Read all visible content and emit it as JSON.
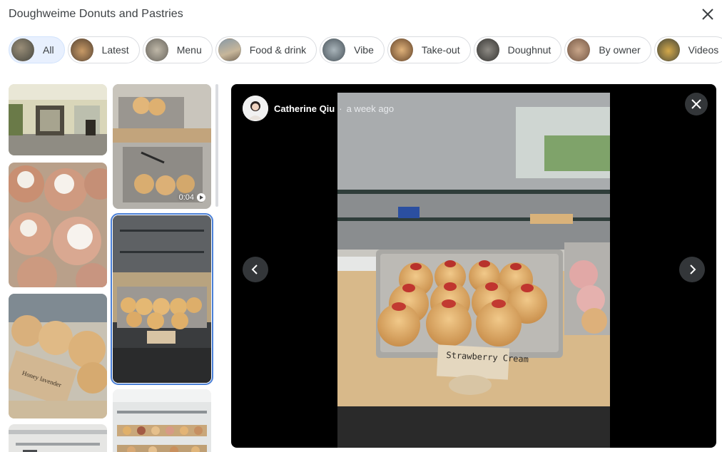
{
  "header": {
    "title": "Doughweime Donuts and Pastries"
  },
  "chips": [
    {
      "label": "All",
      "active": true
    },
    {
      "label": "Latest"
    },
    {
      "label": "Menu"
    },
    {
      "label": "Food & drink"
    },
    {
      "label": "Vibe"
    },
    {
      "label": "Take-out"
    },
    {
      "label": "Doughnut"
    },
    {
      "label": "By owner"
    },
    {
      "label": "Videos"
    }
  ],
  "grid": {
    "video_duration": "0:04"
  },
  "viewer": {
    "author_name": "Catherine Qiu",
    "separator": "·",
    "posted": "a week ago",
    "photo_sign": "Strawberry Cream"
  },
  "colors": {
    "accent": "#4a7fd6",
    "chip_active_bg": "#e8f0fe",
    "viewer_bg": "#000000"
  }
}
